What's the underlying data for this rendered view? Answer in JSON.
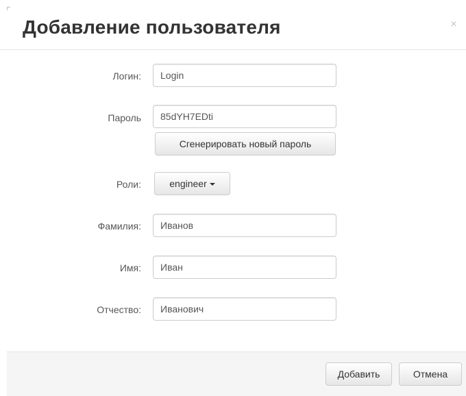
{
  "dialog": {
    "title": "Добавление пользователя",
    "close_glyph": "×"
  },
  "form": {
    "login": {
      "label": "Логин:",
      "value": "Login"
    },
    "password": {
      "label": "Пароль",
      "value": "85dYH7EDti",
      "generate_label": "Сгенерировать новый пароль"
    },
    "roles": {
      "label": "Роли:",
      "selected": "engineer"
    },
    "last_name": {
      "label": "Фамилия:",
      "value": "Иванов"
    },
    "first_name": {
      "label": "Имя:",
      "value": "Иван"
    },
    "middle_name": {
      "label": "Отчество:",
      "value": "Иванович"
    }
  },
  "footer": {
    "add_label": "Добавить",
    "cancel_label": "Отмена"
  },
  "icons": {
    "close": "close-icon",
    "dropdown": "caret-down-icon"
  }
}
